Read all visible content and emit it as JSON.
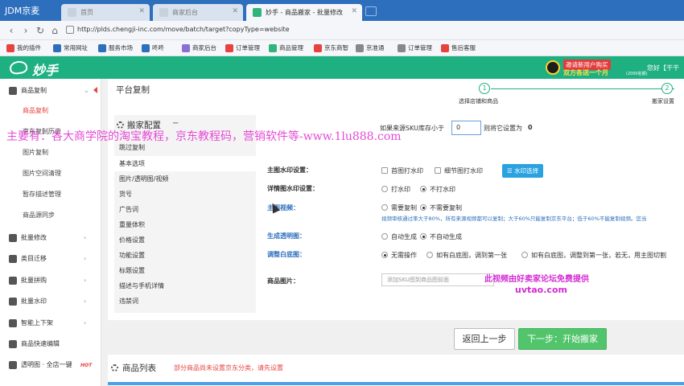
{
  "browser": {
    "app_title": "JDM京麦",
    "tabs": [
      "首页",
      "商家后台",
      "妙手 - 商品搬家 - 批量修改"
    ],
    "url": "http://plds.chengji-inc.com/move/batch/target?copyType=website"
  },
  "bookmarks": [
    {
      "label": "我的插件",
      "color": "#e64340"
    },
    {
      "label": "常用网址",
      "color": "#2d6fbd"
    },
    {
      "label": "服务市场",
      "color": "#2d6fbd"
    },
    {
      "label": "咚咚",
      "color": "#2d6fbd"
    },
    {
      "label": "商家后台",
      "color": "#8a6fd6"
    },
    {
      "label": "订单管理",
      "color": "#e64340"
    },
    {
      "label": "商品管理",
      "color": "#2fb57c"
    },
    {
      "label": "京东商智",
      "color": "#e64340"
    },
    {
      "label": "京准通",
      "color": "#888888"
    },
    {
      "label": "订单管理",
      "color": "#888888"
    },
    {
      "label": "售后客服",
      "color": "#e64340"
    }
  ],
  "header": {
    "logo": "妙手",
    "promo_line1": "邀请新用户购买",
    "promo_line2": "双方各送一个月",
    "promo_line3": "(2000名额)",
    "greeting": "您好【干干"
  },
  "sidebar": {
    "section": "商品复制",
    "sub_items": [
      "商品复制",
      "京东复制历史",
      "图片复制",
      "图片空间清理",
      "暂存描述管理",
      "商品源同步"
    ],
    "items": [
      {
        "label": "批量修改",
        "hot": ""
      },
      {
        "label": "类目迁移",
        "hot": ""
      },
      {
        "label": "批量拼购",
        "hot": ""
      },
      {
        "label": "批量水印",
        "hot": ""
      },
      {
        "label": "智能上下架",
        "hot": ""
      },
      {
        "label": "商品快速编辑",
        "hot": ""
      },
      {
        "label": "透明图 · 全店一键",
        "hot": "HOT"
      }
    ]
  },
  "main": {
    "title": "平台复制",
    "steps": [
      {
        "num": "1",
        "label": "选择店铺和商品"
      },
      {
        "num": "2",
        "label": "搬家设置"
      }
    ],
    "config_title": "搬家配置",
    "config_nav": [
      "跳过复制",
      "基本选项",
      "图片/透明图/视频",
      "货号",
      "广告词",
      "重量体积",
      "价格设置",
      "功能设置",
      "标题设置",
      "描述与手机详情",
      "违禁词"
    ],
    "stock_prefix": "如果来源SKU库存小于",
    "stock_value": "0",
    "stock_suffix": "则将它设置为",
    "stock_set": "0",
    "main_watermark": {
      "label": "主图水印设置：",
      "opt1": "首图打水印",
      "opt2": "细节图打水印",
      "button": "水印选择"
    },
    "detail_watermark": {
      "label": "详情图水印设置：",
      "opt1": "打水印",
      "opt2": "不打水印"
    },
    "main_video": {
      "label": "主图视频：",
      "opt1": "需要复制",
      "opt2": "不需要复制",
      "hint": "视频审核通过率大于80%，所有来源视频都可以复制；大于60%只能复制京东平台；低于60%不能复制视频。您当"
    },
    "transparent": {
      "label": "生成透明图：",
      "opt1": "自动生成",
      "opt2": "不自动生成"
    },
    "white_bg": {
      "label": "调整白底图：",
      "opt1": "无需操作",
      "opt2": "如有白底图，调到第一张",
      "opt3": "如有白底图，调整到第一张，若无，用主图切割"
    },
    "product_image": {
      "label": "商品图片：",
      "placeholder": "添加SKU图到商品图前面"
    },
    "back_button": "返回上一步",
    "next_button": "下一步：开始搬家",
    "list_title": "商品列表",
    "list_note": "部分商品尚未设置京东分类，请先设置"
  },
  "overlays": {
    "red_line": "主要有：各大商学院的淘宝教程，京东教程码，营销软件等-www.1lu888.com",
    "mid_line": "此视频由好卖家论坛免费提供",
    "site_line": "uvtao.com"
  },
  "colors": {
    "brand": "#1fb082",
    "accent_red": "#e64340",
    "link_blue": "#2d6fbd",
    "next_green": "#52c46c"
  }
}
